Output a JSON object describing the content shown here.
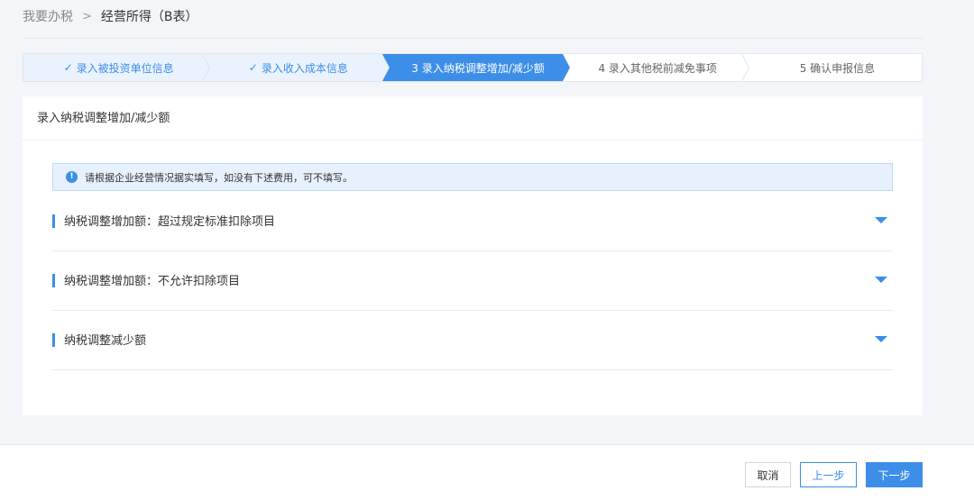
{
  "breadcrumb": {
    "parent": "我要办税",
    "separator": ">",
    "current": "经营所得（B表）"
  },
  "steps": [
    {
      "label": "录入被投资单位信息",
      "status": "done",
      "check": "✓"
    },
    {
      "label": "录入收入成本信息",
      "status": "done",
      "check": "✓"
    },
    {
      "label": "3 录入纳税调整增加/减少额",
      "status": "active"
    },
    {
      "label": "4 录入其他税前减免事项",
      "status": "pending"
    },
    {
      "label": "5 确认申报信息",
      "status": "pending"
    }
  ],
  "panel": {
    "title": "录入纳税调整增加/减少额",
    "notice": {
      "icon": "info-icon",
      "icon_glyph": "!",
      "text": "请根据企业经营情况据实填写，如没有下述费用，可不填写。"
    },
    "sections": [
      {
        "label": "纳税调整增加额：超过规定标准扣除项目"
      },
      {
        "label": "纳税调整增加额：不允许扣除项目"
      },
      {
        "label": "纳税调整减少额"
      }
    ]
  },
  "footer": {
    "cancel_label": "取消",
    "prev_label": "上一步",
    "next_label": "下一步"
  },
  "colors": {
    "accent": "#3d8ee8",
    "background": "#f3f5f8",
    "notice_bg": "#e6f1fd"
  }
}
